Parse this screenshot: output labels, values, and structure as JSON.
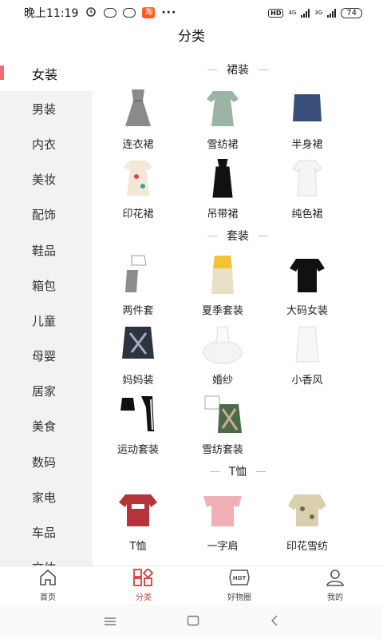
{
  "statusbar": {
    "time": "晚上11:19",
    "app_badge": "淘",
    "hd": "HD",
    "net1": "4G",
    "net2": "3G",
    "battery": "74"
  },
  "header": {
    "title": "分类"
  },
  "sidebar": {
    "items": [
      {
        "label": "女装",
        "active": true
      },
      {
        "label": "男装"
      },
      {
        "label": "内衣"
      },
      {
        "label": "美妆"
      },
      {
        "label": "配饰"
      },
      {
        "label": "鞋品"
      },
      {
        "label": "箱包"
      },
      {
        "label": "儿童"
      },
      {
        "label": "母婴"
      },
      {
        "label": "居家"
      },
      {
        "label": "美食"
      },
      {
        "label": "数码"
      },
      {
        "label": "家电"
      },
      {
        "label": "车品"
      },
      {
        "label": "文体"
      }
    ]
  },
  "sections": [
    {
      "title": "裙装",
      "items": [
        "连衣裙",
        "雪纺裙",
        "半身裙",
        "印花裙",
        "吊带裙",
        "纯色裙"
      ]
    },
    {
      "title": "套装",
      "items": [
        "两件套",
        "夏季套装",
        "大码女装",
        "妈妈装",
        "婚纱",
        "小香风",
        "运动套装",
        "雪纺套装"
      ]
    },
    {
      "title": "T恤",
      "items": [
        "T恤",
        "一字肩",
        "印花雪纺"
      ]
    }
  ],
  "tabbar": {
    "tabs": [
      {
        "label": "首页"
      },
      {
        "label": "分类",
        "active": true
      },
      {
        "label": "好物圈"
      },
      {
        "label": "我的"
      }
    ],
    "hot_badge": "HOT"
  },
  "colors": {
    "accent": "#d63a3a",
    "sidebar_marker": "#f06a7a"
  }
}
